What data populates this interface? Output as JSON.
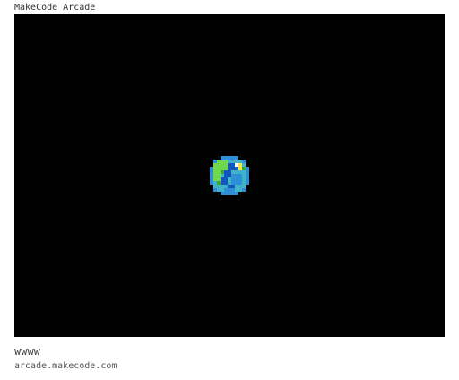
{
  "header": {
    "title": "MakeCode Arcade"
  },
  "game": {
    "sprite_icon": "earth-planet-icon",
    "background_color": "#000000",
    "sprite_colors": {
      "ocean_dark": "#1457b8",
      "ocean": "#2f8fd6",
      "ocean_light": "#3fb3c9",
      "land": "#6fd84c",
      "land_dark": "#3aa83c",
      "highlight": "#ffffff",
      "sun_glint": "#f5e94a"
    }
  },
  "footer": {
    "name": "wwww",
    "url": "arcade.makecode.com"
  }
}
